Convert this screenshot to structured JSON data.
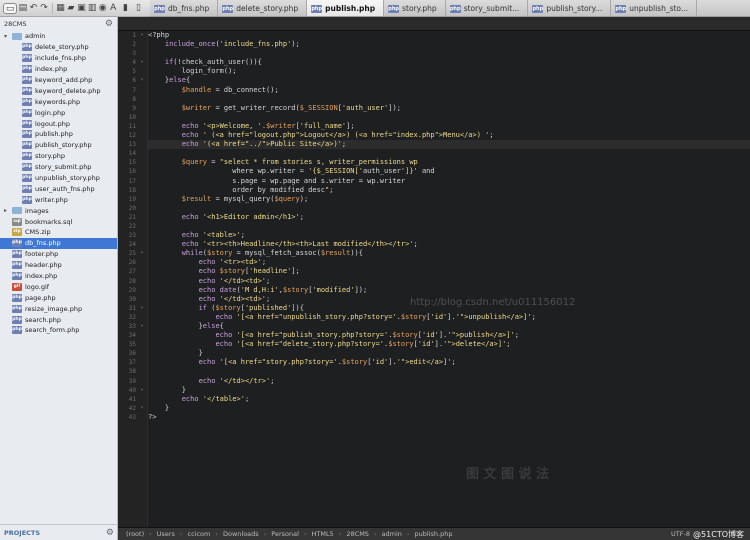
{
  "toolbar": {
    "buttons": [
      "new-file",
      "open",
      "back",
      "forward",
      "save",
      "open-folder",
      "new-window",
      "preview",
      "browser",
      "browser-b",
      "annotate",
      "layout-1",
      "layout-2",
      "layout-3",
      "layout-4",
      "record",
      "play",
      "circle",
      "square",
      "settings"
    ]
  },
  "tabs": [
    {
      "label": "db_fns.php",
      "active": false
    },
    {
      "label": "delete_story.php",
      "active": false
    },
    {
      "label": "publish.php",
      "active": true
    },
    {
      "label": "story.php",
      "active": false
    },
    {
      "label": "story_submit...",
      "active": false
    },
    {
      "label": "publish_story...",
      "active": false
    },
    {
      "label": "unpublish_sto...",
      "active": false
    }
  ],
  "sidebar": {
    "project": "28CMS",
    "folder": "admin",
    "admin_files": [
      {
        "name": "delete_story.php",
        "type": "php"
      },
      {
        "name": "include_fns.php",
        "type": "php"
      },
      {
        "name": "index.php",
        "type": "php"
      },
      {
        "name": "keyword_add.php",
        "type": "php"
      },
      {
        "name": "keyword_delete.php",
        "type": "php"
      },
      {
        "name": "keywords.php",
        "type": "php"
      },
      {
        "name": "login.php",
        "type": "php"
      },
      {
        "name": "logout.php",
        "type": "php"
      },
      {
        "name": "publish.php",
        "type": "php"
      },
      {
        "name": "publish_story.php",
        "type": "php"
      },
      {
        "name": "story.php",
        "type": "php"
      },
      {
        "name": "story_submit.php",
        "type": "php"
      },
      {
        "name": "unpublish_story.php",
        "type": "php"
      },
      {
        "name": "user_auth_fns.php",
        "type": "php"
      },
      {
        "name": "writer.php",
        "type": "php"
      }
    ],
    "root_items": [
      {
        "name": "images",
        "type": "folder",
        "selected": false
      },
      {
        "name": "bookmarks.sql",
        "type": "sql",
        "selected": false
      },
      {
        "name": "CMS.zip",
        "type": "zip",
        "selected": false
      },
      {
        "name": "db_fns.php",
        "type": "php",
        "selected": true
      },
      {
        "name": "footer.php",
        "type": "php",
        "selected": false
      },
      {
        "name": "header.php",
        "type": "php",
        "selected": false
      },
      {
        "name": "index.php",
        "type": "php",
        "selected": false
      },
      {
        "name": "logo.gif",
        "type": "gif",
        "selected": false
      },
      {
        "name": "page.php",
        "type": "php",
        "selected": false
      },
      {
        "name": "resize_image.php",
        "type": "php",
        "selected": false
      },
      {
        "name": "search.php",
        "type": "php",
        "selected": false
      },
      {
        "name": "search_form.php",
        "type": "php",
        "selected": false
      }
    ],
    "footer_label": "PROJECTS"
  },
  "editor": {
    "lines": [
      "<?php",
      "    include_once('include_fns.php');",
      "",
      "    if(!check_auth_user()){",
      "        login_form();",
      "    }else{",
      "        $handle = db_connect();",
      "",
      "        $writer = get_writer_record($_SESSION['auth_user']);",
      "",
      "        echo '<p>Welcome, '.$writer['full_name'];",
      "        echo ' (<a href=\"logout.php\">Logout</a>) (<a href=\"index.php\">Menu</a>) ';",
      "        echo '(<a href=\"../\">Public Site</a>)';",
      "",
      "        $query = \"select * from stories s, writer_permissions wp",
      "                    where wp.writer = '{$_SESSION['auth_user']}' and",
      "                    s.page = wp.page and s.writer = wp.writer",
      "                    order by modified desc\";",
      "        $result = mysql_query($query);",
      "",
      "        echo '<h1>Editor admin</h1>';",
      "",
      "        echo '<table>';",
      "        echo '<tr><th>Headline</th><th>Last modified</th></tr>';",
      "        while($story = mysql_fetch_assoc($result)){",
      "            echo '<tr><td>';",
      "            echo $story['headline'];",
      "            echo '</td><td>';",
      "            echo date('M d,H:i',$story['modified']);",
      "            echo '</td><td>';",
      "            if ($story['published']){",
      "                echo '[<a href=\"unpublish_story.php?story='.$story['id'].'\">unpublish</a>]';",
      "            }else{",
      "                echo '[<a href=\"publish_story.php?story='.$story['id'].'\">publish</a>]';",
      "                echo '[<a href=\"delete_story.php?story='.$story['id'].'\">delete</a>]';",
      "            }",
      "            echo '[<a href=\"story.php?story='.$story['id'].'\">edit</a>]';",
      "",
      "            echo '</td></tr>';",
      "        }",
      "        echo '</table>';",
      "    }",
      "?>"
    ],
    "current_line": 13,
    "fold_lines": [
      1,
      4,
      6,
      25,
      31,
      33,
      40,
      42
    ],
    "watermark": "http://blog.csdn.net/u011156012",
    "watermark2": "图 文 图 说 法"
  },
  "statusbar": {
    "breadcrumbs": [
      "(root)",
      "Users",
      "ccicom",
      "Downloads",
      "Personal",
      "HTML5",
      "28CMS",
      "admin",
      "publish.php"
    ],
    "encoding": "UTF-8",
    "corner": "@51CTO博客"
  }
}
